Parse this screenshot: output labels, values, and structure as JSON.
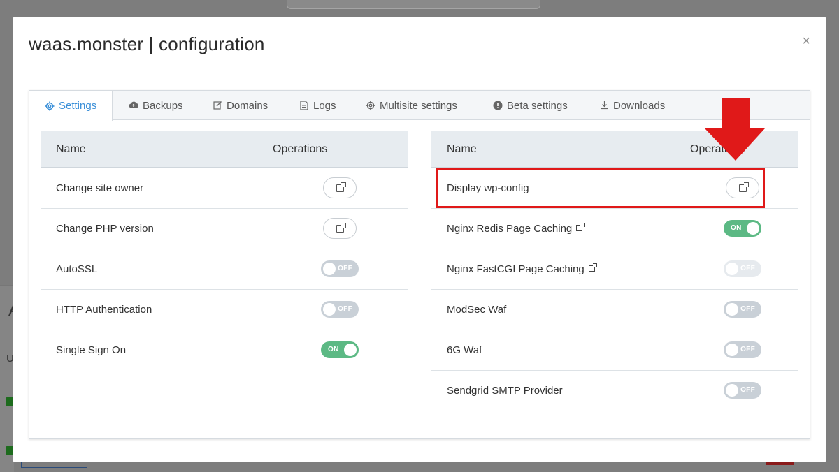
{
  "modal": {
    "title": "waas.monster | configuration",
    "close_icon": "×"
  },
  "tabs": [
    {
      "label": "Settings",
      "icon": "gear-icon",
      "active": true
    },
    {
      "label": "Backups",
      "icon": "cloud-upload-icon",
      "active": false
    },
    {
      "label": "Domains",
      "icon": "edit-icon",
      "active": false
    },
    {
      "label": "Logs",
      "icon": "file-icon",
      "active": false
    },
    {
      "label": "Multisite settings",
      "icon": "gear-icon",
      "active": false
    },
    {
      "label": "Beta settings",
      "icon": "info-icon",
      "active": false
    },
    {
      "label": "Downloads",
      "icon": "download-icon",
      "active": false
    }
  ],
  "left_table": {
    "headers": {
      "name": "Name",
      "operations": "Operations"
    },
    "rows": [
      {
        "name": "Change site owner",
        "op": "button"
      },
      {
        "name": "Change PHP version",
        "op": "button"
      },
      {
        "name": "AutoSSL",
        "op": "toggle",
        "state": "OFF"
      },
      {
        "name": "HTTP Authentication",
        "op": "toggle",
        "state": "OFF"
      },
      {
        "name": "Single Sign On",
        "op": "toggle",
        "state": "ON"
      }
    ]
  },
  "right_table": {
    "headers": {
      "name": "Name",
      "operations": "Operations"
    },
    "rows": [
      {
        "name": "Display wp-config",
        "op": "button"
      },
      {
        "name": "Nginx Redis Page Caching",
        "op": "toggle",
        "state": "ON",
        "external_link": true
      },
      {
        "name": "Nginx FastCGI Page Caching",
        "op": "toggle",
        "state": "OFF",
        "external_link": true,
        "disabled": true
      },
      {
        "name": "ModSec Waf",
        "op": "toggle",
        "state": "OFF"
      },
      {
        "name": "6G Waf",
        "op": "toggle",
        "state": "OFF"
      },
      {
        "name": "Sendgrid SMTP Provider",
        "op": "toggle",
        "state": "OFF"
      }
    ]
  },
  "toggle_labels": {
    "on": "ON",
    "off": "OFF"
  },
  "colors": {
    "accent": "#3a8fd8",
    "toggle_on": "#5cb984",
    "toggle_off": "#c9d0d7",
    "highlight": "#e01919"
  }
}
